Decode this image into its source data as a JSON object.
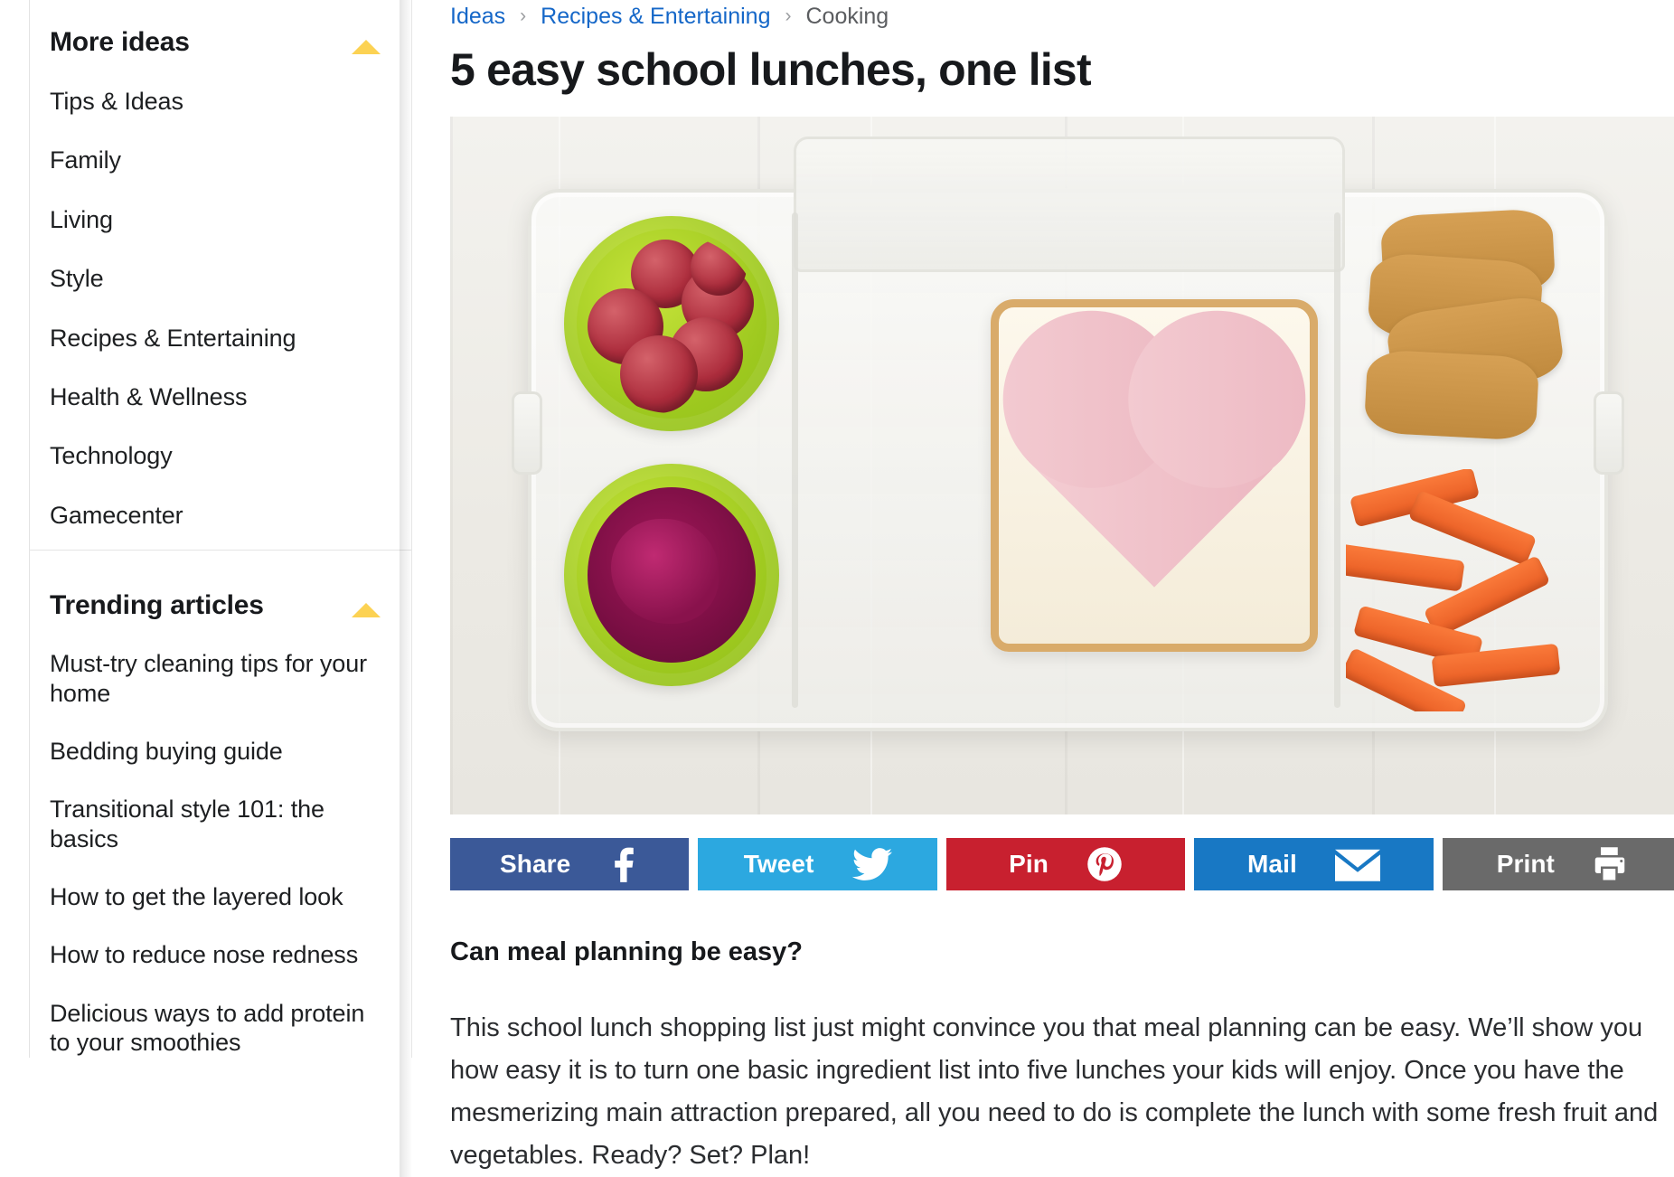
{
  "sidebar": {
    "more_ideas": {
      "title": "More ideas",
      "collapse_icon": "caret-up-icon",
      "items": [
        {
          "label": "Tips & Ideas"
        },
        {
          "label": "Family"
        },
        {
          "label": "Living"
        },
        {
          "label": "Style"
        },
        {
          "label": "Recipes & Entertaining"
        },
        {
          "label": "Health & Wellness"
        },
        {
          "label": "Technology"
        },
        {
          "label": "Gamecenter"
        }
      ]
    },
    "trending": {
      "title": "Trending articles",
      "collapse_icon": "caret-up-icon",
      "items": [
        {
          "label": "Must-try cleaning tips for your home"
        },
        {
          "label": "Bedding buying guide"
        },
        {
          "label": "Transitional style 101: the basics"
        },
        {
          "label": "How to get the layered look"
        },
        {
          "label": "How to reduce nose redness"
        },
        {
          "label": "Delicious ways to add protein to your smoothies"
        }
      ]
    }
  },
  "breadcrumb": {
    "separator": "›",
    "items": [
      {
        "label": "Ideas",
        "link": true
      },
      {
        "label": "Recipes & Entertaining",
        "link": true
      },
      {
        "label": "Cooking",
        "link": false
      }
    ]
  },
  "article": {
    "headline": "5 easy school lunches, one list",
    "hero_image_alt": "Bento lunchbox with red grapes, beet dip, heart-shaped jam sandwich, crackers and carrot sticks",
    "subheading": "Can meal planning be easy?",
    "paragraph": "This school lunch shopping list just might convince you that meal planning can be easy. We’ll show you how easy it is to turn one basic ingredient list into five lunches your kids will enjoy. Once you have the mesmerizing main attraction prepared, all you need to do is complete the lunch with some fresh fruit and vegetables. Ready? Set? Plan!"
  },
  "share_bar": {
    "buttons": [
      {
        "label": "Share",
        "icon": "facebook-icon",
        "color": "#3B5998"
      },
      {
        "label": "Tweet",
        "icon": "twitter-bird-icon",
        "color": "#2CA8E0"
      },
      {
        "label": "Pin",
        "icon": "pinterest-icon",
        "color": "#C8202F"
      },
      {
        "label": "Mail",
        "icon": "envelope-icon",
        "color": "#1878C4"
      },
      {
        "label": "Print",
        "icon": "printer-icon",
        "color": "#6A6A6A"
      }
    ]
  },
  "colors": {
    "link": "#1567C8",
    "caret_yellow": "#FCD253",
    "text": "#17191C"
  }
}
